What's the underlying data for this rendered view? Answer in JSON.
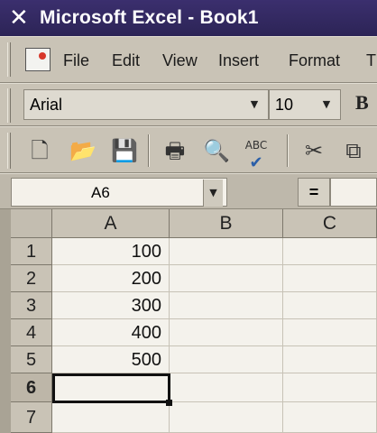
{
  "window": {
    "title": "Microsoft Excel - Book1",
    "app_icon": "excel-x-icon"
  },
  "menu": {
    "items": [
      "File",
      "Edit",
      "View",
      "Insert",
      "Format",
      "T"
    ]
  },
  "format_toolbar": {
    "font": "Arial",
    "size": "10",
    "bold": "B"
  },
  "standard_toolbar": {
    "icons": [
      "new-icon",
      "open-icon",
      "save-icon",
      "print-icon",
      "print-preview-icon",
      "spelling-icon",
      "cut-icon",
      "copy-icon"
    ],
    "spelling_glyph": "ABC"
  },
  "formula_bar": {
    "name_box": "A6",
    "equals": "="
  },
  "grid": {
    "columns": [
      "A",
      "B",
      "C"
    ],
    "rows": [
      "1",
      "2",
      "3",
      "4",
      "5",
      "6",
      "7"
    ],
    "cells": {
      "A1": "100",
      "A2": "200",
      "A3": "300",
      "A4": "400",
      "A5": "500"
    },
    "active_cell": "A6"
  },
  "colors": {
    "title_bar": "#2c2456",
    "chrome": "#c9c3b6",
    "cell_bg": "#f4f2ec"
  }
}
